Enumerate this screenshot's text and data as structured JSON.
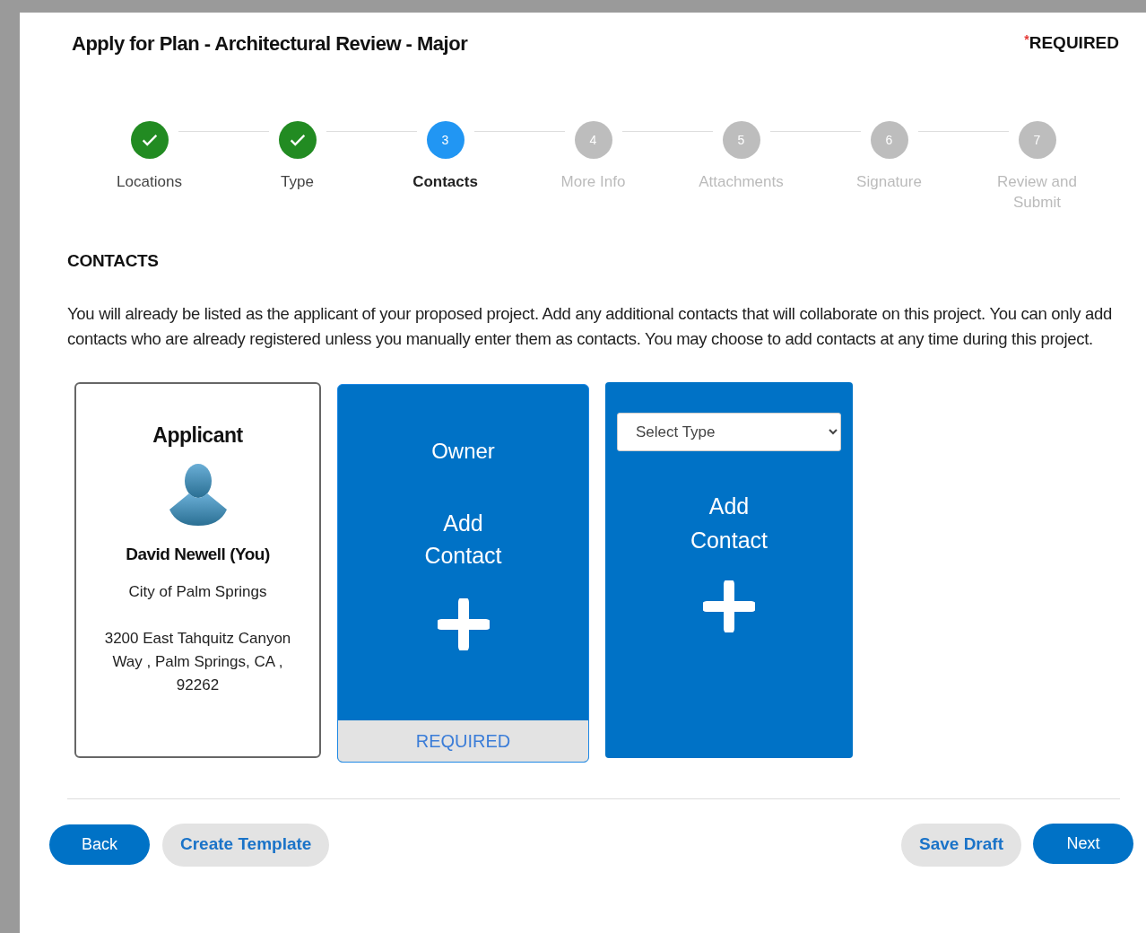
{
  "header": {
    "title": "Apply for Plan - Architectural Review - Major",
    "required_mark": "*",
    "required_label": "REQUIRED"
  },
  "steps": [
    {
      "label": "Locations",
      "completed": true,
      "selected": false
    },
    {
      "label": "Type",
      "completed": true,
      "selected": false
    },
    {
      "number": "3",
      "label": "Contacts",
      "completed": false,
      "selected": true
    },
    {
      "number": "4",
      "label": "More Info",
      "completed": false,
      "selected": false
    },
    {
      "number": "5",
      "label": "Attachments",
      "completed": false,
      "selected": false
    },
    {
      "number": "6",
      "label": "Signature",
      "completed": false,
      "selected": false
    },
    {
      "number": "7",
      "label": "Review and Submit",
      "completed": false,
      "selected": false
    }
  ],
  "section": {
    "heading": "CONTACTS",
    "description": "You will already be listed as the applicant of your proposed project. Add any additional contacts that will collaborate on this project. You can only add contacts who are already registered unless you manually enter them as contacts. You may choose to add contacts at any time during this project."
  },
  "cards": [
    {
      "kind": "person",
      "title": "Applicant",
      "name": "David Newell (You)",
      "organization": "City of Palm Springs",
      "address": "3200 East Tahquitz Canyon Way , Palm Springs, CA , 92262"
    },
    {
      "kind": "role",
      "title": "Owner",
      "action": "Add Contact",
      "footer": "REQUIRED"
    },
    {
      "kind": "select",
      "select_value": "Select Type",
      "action": "Add Contact"
    }
  ],
  "footer": {
    "left_buttons": [
      {
        "label": "Back",
        "kind": "primary"
      },
      {
        "label": "Create Template",
        "kind": "secondary"
      }
    ],
    "right_buttons": [
      {
        "label": "Save Draft",
        "kind": "secondary"
      },
      {
        "label": "Next",
        "kind": "primary"
      }
    ]
  }
}
